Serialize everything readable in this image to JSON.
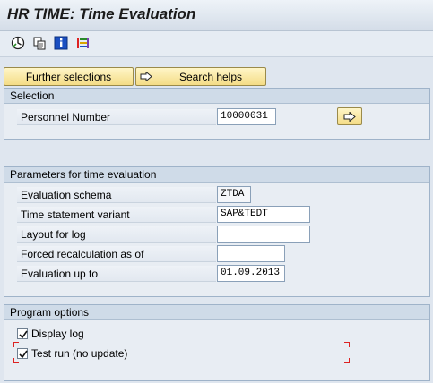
{
  "window": {
    "title": "HR TIME: Time Evaluation"
  },
  "toolbar": {
    "icons": [
      "execute-icon",
      "copy-icon",
      "info-icon",
      "layout-icon"
    ]
  },
  "buttons": {
    "further_selections": "Further selections",
    "search_helps": "Search helps"
  },
  "selection": {
    "header": "Selection",
    "personnel_label": "Personnel Number",
    "personnel_value": "10000031"
  },
  "parameters": {
    "header": "Parameters for time evaluation",
    "fields": [
      {
        "label": "Evaluation schema",
        "value": "ZTDA"
      },
      {
        "label": "Time statement variant",
        "value": "SAP&TEDT"
      },
      {
        "label": "Layout for log",
        "value": ""
      },
      {
        "label": "Forced recalculation as of",
        "value": ""
      },
      {
        "label": "Evaluation up to",
        "value": "01.09.2013"
      }
    ]
  },
  "options": {
    "header": "Program options",
    "display_log": {
      "label": "Display log",
      "checked": true
    },
    "test_run": {
      "label": "Test run (no update)",
      "checked": true
    }
  },
  "colors": {
    "accent_button": "#f4dc86",
    "focus_bracket": "#dd2222"
  }
}
